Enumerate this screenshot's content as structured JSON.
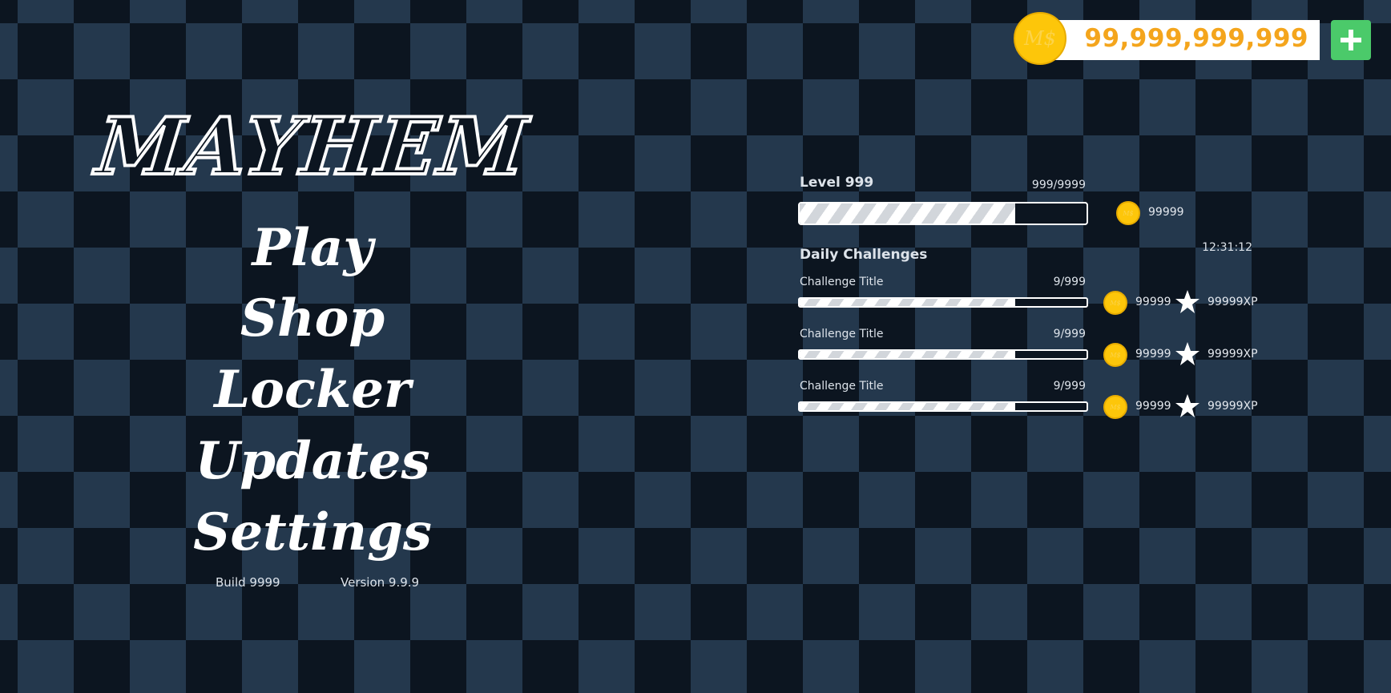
{
  "currency": {
    "amount": "99,999,999,999",
    "coin_symbol": "M$",
    "add_label": "+"
  },
  "logo": {
    "text": "MAYHEM"
  },
  "menu": {
    "items": [
      {
        "label": "Play"
      },
      {
        "label": "Shop"
      },
      {
        "label": "Locker"
      },
      {
        "label": "Updates"
      },
      {
        "label": "Settings"
      }
    ]
  },
  "footer": {
    "build": "Build 9999",
    "version": "Version 9.9.9"
  },
  "level": {
    "title": "Level 999",
    "xp_text": "999/9999",
    "progress": 0.75,
    "coin_reward": "99999"
  },
  "daily": {
    "title": "Daily Challenges",
    "timer": "12:31:12",
    "challenges": [
      {
        "title": "Challenge Title",
        "progress_text": "9/999",
        "progress": 0.75,
        "coin_reward": "99999",
        "xp_reward": "99999XP"
      },
      {
        "title": "Challenge Title",
        "progress_text": "9/999",
        "progress": 0.75,
        "coin_reward": "99999",
        "xp_reward": "99999XP"
      },
      {
        "title": "Challenge Title",
        "progress_text": "9/999",
        "progress": 0.75,
        "coin_reward": "99999",
        "xp_reward": "99999XP"
      }
    ]
  },
  "colors": {
    "accent_gold": "#f4a51c",
    "coin": "#fdc60a",
    "add_button": "#4bca6a"
  },
  "icons": [
    "coin-icon",
    "plus-icon",
    "star-icon"
  ]
}
